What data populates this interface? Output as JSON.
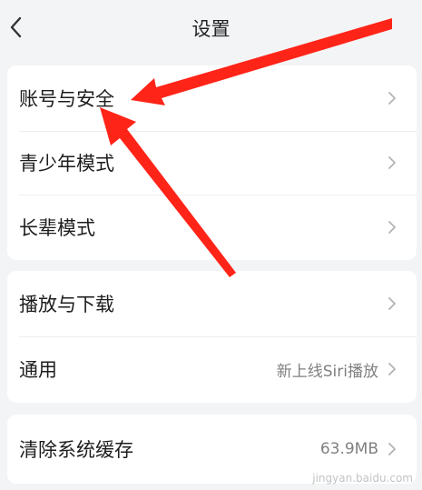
{
  "header": {
    "title": "设置"
  },
  "sections": [
    {
      "items": [
        {
          "label": "账号与安全"
        },
        {
          "label": "青少年模式"
        },
        {
          "label": "长辈模式"
        }
      ]
    },
    {
      "items": [
        {
          "label": "播放与下载"
        },
        {
          "label": "通用",
          "value": "新上线Siri播放"
        }
      ]
    },
    {
      "items": [
        {
          "label": "清除系统缓存",
          "value": "63.9MB"
        }
      ]
    }
  ],
  "icons": {
    "back": "chevron-left-icon",
    "row": "chevron-right-icon"
  },
  "colors": {
    "annotation_arrow": "#ff2418",
    "background": "#f3f4f6",
    "card": "#ffffff"
  },
  "watermark": "jingyan.baidu.com"
}
